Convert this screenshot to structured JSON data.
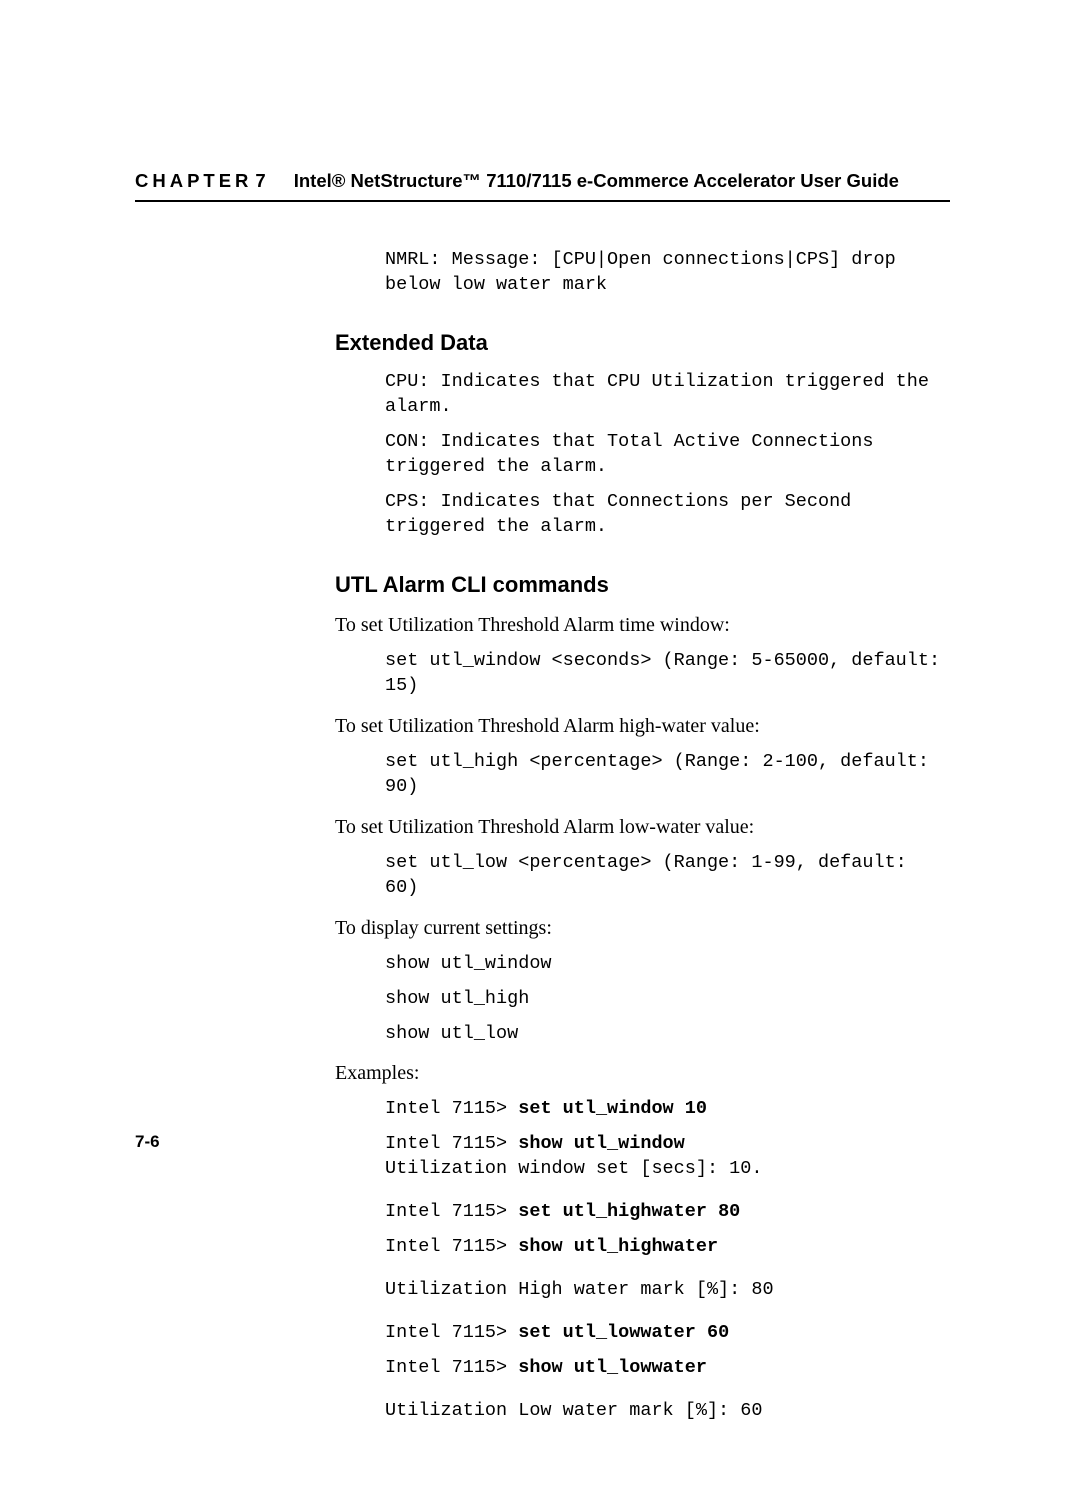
{
  "header": {
    "chapter_word": "CHAPTER",
    "chapter_num": "7",
    "title": "Intel® NetStructure™ 7110/7115 e-Commerce Accelerator User Guide"
  },
  "intro_mono": "NMRL: Message: [CPU|Open connections|CPS] drop below low water mark",
  "sections": {
    "extended_data": {
      "heading": "Extended Data",
      "lines": [
        "CPU: Indicates that CPU Utilization triggered the alarm.",
        "CON: Indicates that Total Active Connections triggered the alarm.",
        "CPS: Indicates that Connections per Second triggered the alarm."
      ]
    },
    "utl_cli": {
      "heading": "UTL Alarm CLI commands",
      "p_set_window": "To set Utilization Threshold Alarm time window:",
      "c_set_window": "set utl_window <seconds> (Range: 5-65000, default: 15)",
      "p_set_high": "To set Utilization Threshold Alarm high-water value:",
      "c_set_high": "set utl_high <percentage> (Range: 2-100, default: 90)",
      "p_set_low": "To set Utilization Threshold Alarm low-water value:",
      "c_set_low": "set utl_low <percentage> (Range: 1-99, default: 60)",
      "p_display": "To display current settings:",
      "c_show_window": "show utl_window",
      "c_show_high": "show utl_high",
      "c_show_low": "show utl_low",
      "p_examples": "Examples:",
      "ex": {
        "prompt": "Intel 7115> ",
        "l1_cmd": "set utl_window 10",
        "l2_cmd": "show utl_window",
        "l3_out": "Utilization window set [secs]: 10.",
        "l4_cmd": "set utl_highwater 80",
        "l5_cmd": "show utl_highwater",
        "l6_out": "Utilization High water mark [%]: 80",
        "l7_cmd": "set utl_lowwater 60",
        "l8_cmd": "show utl_lowwater",
        "l9_out": "Utilization Low water mark [%]: 60"
      }
    }
  },
  "footer": "7-6"
}
